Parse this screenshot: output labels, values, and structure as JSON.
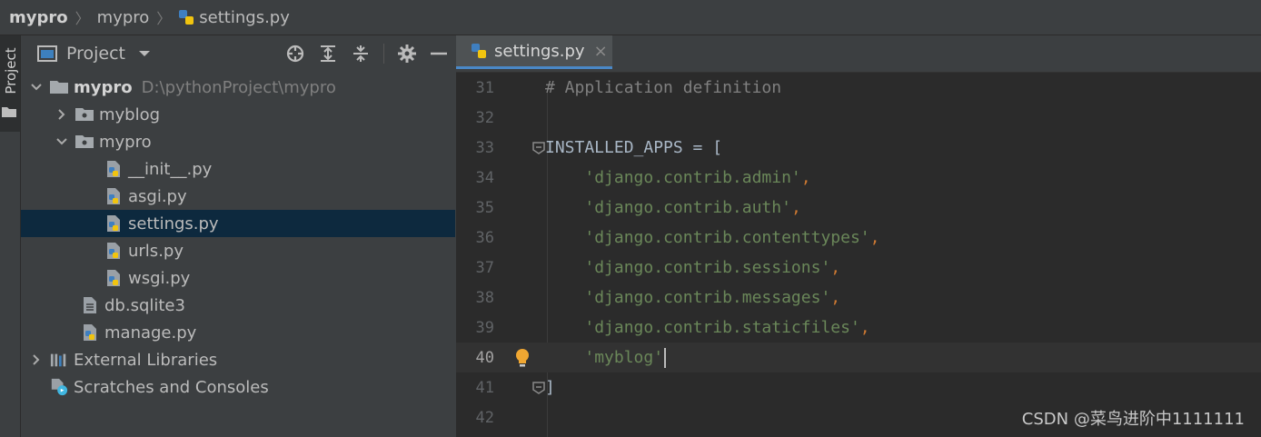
{
  "breadcrumb": {
    "items": [
      "mypro",
      "mypro",
      "settings.py"
    ]
  },
  "tool_stripe": {
    "label": "Project"
  },
  "project_panel": {
    "title": "Project",
    "tree": [
      {
        "label": "mypro",
        "path": "D:\\pythonProject\\mypro",
        "type": "folder",
        "expanded": true
      },
      {
        "label": "myblog",
        "type": "package",
        "expanded": false
      },
      {
        "label": "mypro",
        "type": "package",
        "expanded": true
      },
      {
        "label": "__init__.py",
        "type": "python"
      },
      {
        "label": "asgi.py",
        "type": "python"
      },
      {
        "label": "settings.py",
        "type": "python",
        "selected": true
      },
      {
        "label": "urls.py",
        "type": "python"
      },
      {
        "label": "wsgi.py",
        "type": "python"
      },
      {
        "label": "db.sqlite3",
        "type": "file"
      },
      {
        "label": "manage.py",
        "type": "python"
      },
      {
        "label": "External Libraries",
        "type": "libraries",
        "expanded": false
      },
      {
        "label": "Scratches and Consoles",
        "type": "scratches"
      }
    ]
  },
  "editor": {
    "tab_label": "settings.py",
    "tab_close": "×",
    "lines": [
      {
        "n": "31",
        "parts": [
          [
            "cmt",
            "# Application definition"
          ]
        ]
      },
      {
        "n": "32",
        "parts": []
      },
      {
        "n": "33",
        "parts": [
          [
            "txt",
            "INSTALLED_APPS = ["
          ]
        ]
      },
      {
        "n": "34",
        "parts": [
          [
            "txt",
            "    "
          ],
          [
            "str",
            "'django.contrib.admin'"
          ],
          [
            "punc",
            ","
          ]
        ]
      },
      {
        "n": "35",
        "parts": [
          [
            "txt",
            "    "
          ],
          [
            "str",
            "'django.contrib.auth'"
          ],
          [
            "punc",
            ","
          ]
        ]
      },
      {
        "n": "36",
        "parts": [
          [
            "txt",
            "    "
          ],
          [
            "str",
            "'django.contrib.contenttypes'"
          ],
          [
            "punc",
            ","
          ]
        ]
      },
      {
        "n": "37",
        "parts": [
          [
            "txt",
            "    "
          ],
          [
            "str",
            "'django.contrib.sessions'"
          ],
          [
            "punc",
            ","
          ]
        ]
      },
      {
        "n": "38",
        "parts": [
          [
            "txt",
            "    "
          ],
          [
            "str",
            "'django.contrib.messages'"
          ],
          [
            "punc",
            ","
          ]
        ]
      },
      {
        "n": "39",
        "parts": [
          [
            "txt",
            "    "
          ],
          [
            "str",
            "'django.contrib.staticfiles'"
          ],
          [
            "punc",
            ","
          ]
        ]
      },
      {
        "n": "40",
        "parts": [
          [
            "txt",
            "    "
          ],
          [
            "str",
            "'myblog'"
          ]
        ]
      },
      {
        "n": "41",
        "parts": [
          [
            "txt",
            "]"
          ]
        ]
      },
      {
        "n": "42",
        "parts": []
      }
    ]
  },
  "watermark": "CSDN @菜鸟进阶中1111111",
  "colors": {
    "editor_bg": "#2b2b2b",
    "panel_bg": "#3c3f41",
    "selection": "#0d293e",
    "string": "#6a8759",
    "comment": "#808080",
    "keyword_punct": "#cc7832",
    "tab_underline": "#4a88c7"
  }
}
